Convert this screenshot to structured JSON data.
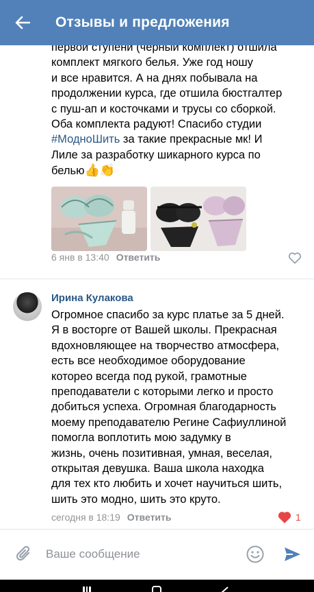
{
  "header": {
    "title": "Отзывы и предложения"
  },
  "comments": [
    {
      "text_lines": [
        "первой ступени (черный комплект) отшила",
        "комплект мягкого белья. Уже год ношу",
        "и все нравится. А на днях побывала на",
        "продолжении курса, где отшила бюстгалтер",
        "с пуш-ап и косточками и трусы со сборкой.",
        "Оба комплекта радуют! Спасибо студии"
      ],
      "hashtag": "#МодноШить",
      "text_after_tag": " за такие прекрасные мк! И",
      "text_tail_1": "Лиле за разработку шикарного курса по",
      "text_tail_2": "белью",
      "emoji": "👍👏",
      "date": "6 янв в 13:40",
      "reply": "Ответить"
    },
    {
      "author": "Ирина Кулакова",
      "text_lines": [
        "Огромное спасибо за курс платье за 5 дней.",
        "Я в восторге от Вашей школы. Прекрасная",
        "вдохновляющее на творчество атмосфера,",
        "есть все необходимое оборудование",
        "котореo всегда под рукой, грамотные",
        "преподаватели с которыми легко и просто",
        "добиться успеха. Огромная благодарность",
        "моему преподавателю Регине Сафиуллиной",
        "помогла воплотить мою задумку в",
        "жизнь, очень позитивная, умная, веселая,",
        "открытая девушка. Ваша школа находка",
        "для тех кто любить и хочет научиться шить,",
        "шить это модно, шить это круто."
      ],
      "date": "сегодня в 18:19",
      "reply": "Ответить",
      "likes": "1"
    }
  ],
  "composer": {
    "placeholder": "Ваше сообщение"
  },
  "icons": {
    "back": "arrow-left-icon",
    "like": "heart-icon",
    "attach": "paperclip-icon",
    "emoji": "smile-icon",
    "send": "send-icon"
  },
  "colors": {
    "accent": "#5181b8",
    "link": "#2a5885",
    "like_active": "#e64646"
  }
}
